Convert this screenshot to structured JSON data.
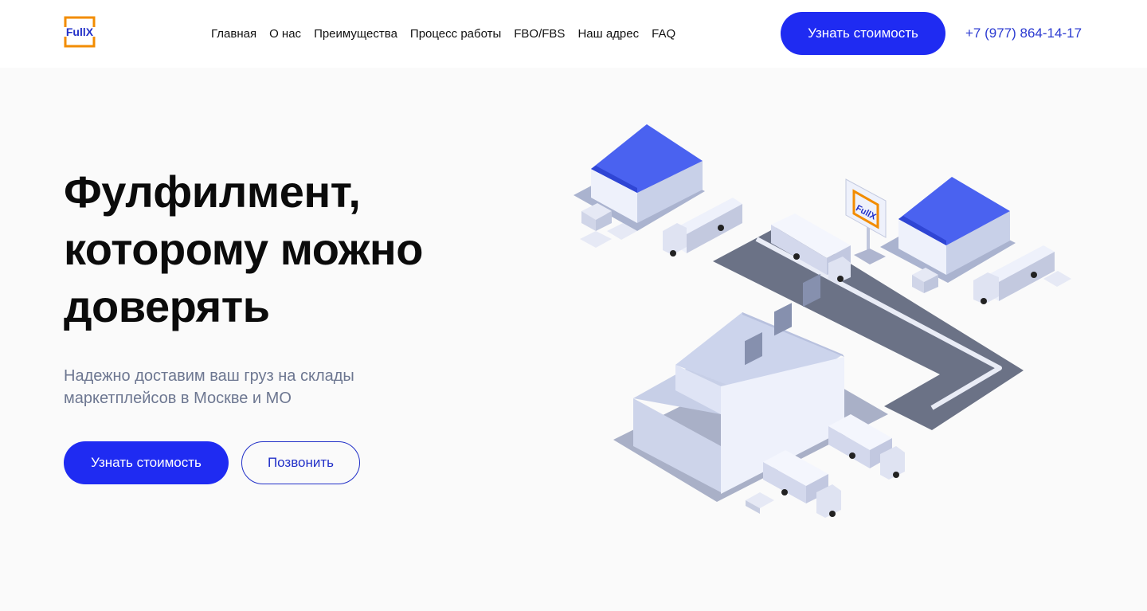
{
  "header": {
    "logo_text": "FullX",
    "nav": [
      {
        "label": "Главная"
      },
      {
        "label": "О нас"
      },
      {
        "label": "Преимущества"
      },
      {
        "label": "Процесс работы"
      },
      {
        "label": "FBO/FBS"
      },
      {
        "label": "Наш адрес"
      },
      {
        "label": "FAQ"
      }
    ],
    "cta_label": "Узнать стоимость",
    "phone": "+7 (977) 864-14-17"
  },
  "hero": {
    "title_lines": [
      "Фулфилмент,",
      "которому можно",
      "доверять"
    ],
    "subtitle_lines": [
      "Надежно доставим ваш груз на склады",
      "маркетплейсов в Москве и МО"
    ],
    "primary_label": "Узнать стоимость",
    "secondary_label": "Позвонить"
  },
  "illustration": {
    "sign_text": "FullX"
  },
  "colors": {
    "accent": "#1f2bf2",
    "logo_orange": "#f28c00",
    "road": "#6b7286",
    "roof_blue": "#4a62f0"
  }
}
